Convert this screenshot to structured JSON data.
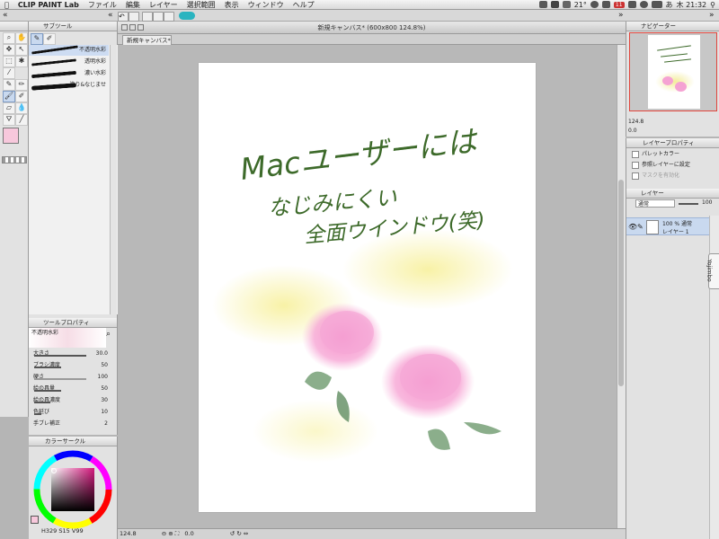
{
  "menubar": {
    "app_name": "CLIP PAINT Lab",
    "items": [
      "ファイル",
      "編集",
      "レイヤー",
      "選択範囲",
      "表示",
      "ウィンドウ",
      "ヘルプ"
    ],
    "temperature": "21°",
    "badge": "11",
    "ime": "あ",
    "clock": "木 21:32"
  },
  "sub_tool": {
    "tab_label": "サブツール",
    "brushes": [
      "不透明水彩",
      "透明水彩",
      "濃い水彩",
      "塗り&なじませ"
    ]
  },
  "tool_property": {
    "tab_label": "ツールプロパティ",
    "brush_name": "不透明水彩",
    "rows": [
      {
        "label": "大きさ",
        "value": "30.0"
      },
      {
        "label": "ブラシ濃度",
        "value": "50"
      },
      {
        "label": "硬さ",
        "value": "100"
      },
      {
        "label": "絵の具量",
        "value": "50"
      },
      {
        "label": "絵の具濃度",
        "value": "30"
      },
      {
        "label": "色延び",
        "value": "10"
      },
      {
        "label": "手ブレ補正",
        "value": "2"
      }
    ]
  },
  "color_panel": {
    "tab_label": "カラーサークル",
    "readout_h": "329",
    "readout_s": "15",
    "readout_v": "99",
    "main_color": "#f7c8dc"
  },
  "canvas": {
    "window_title": "新規キャンバス* (600x800 124.8%)",
    "tab_label": "新規キャンバス*",
    "zoom": "124.8",
    "rotation": "0.0",
    "handwriting": [
      "Macユーザーには",
      "なじみにくい",
      "全面ウインドウ(笑)"
    ],
    "ink_color": "#3d6a2a"
  },
  "navigator": {
    "tab_label": "ナビゲーター",
    "zoom": "124.8",
    "rotation": "0.0"
  },
  "layer_property": {
    "tab_label": "レイヤープロパティ",
    "options": [
      "パレットカラー",
      "参照レイヤーに設定",
      "マスクを有効化"
    ]
  },
  "layers": {
    "tab_label": "レイヤー",
    "blend_mode": "通常",
    "opacity": "100",
    "layer_info": "100 % 通常",
    "layer_name": "レイヤー 1"
  },
  "side_tab": "Yojimbo"
}
